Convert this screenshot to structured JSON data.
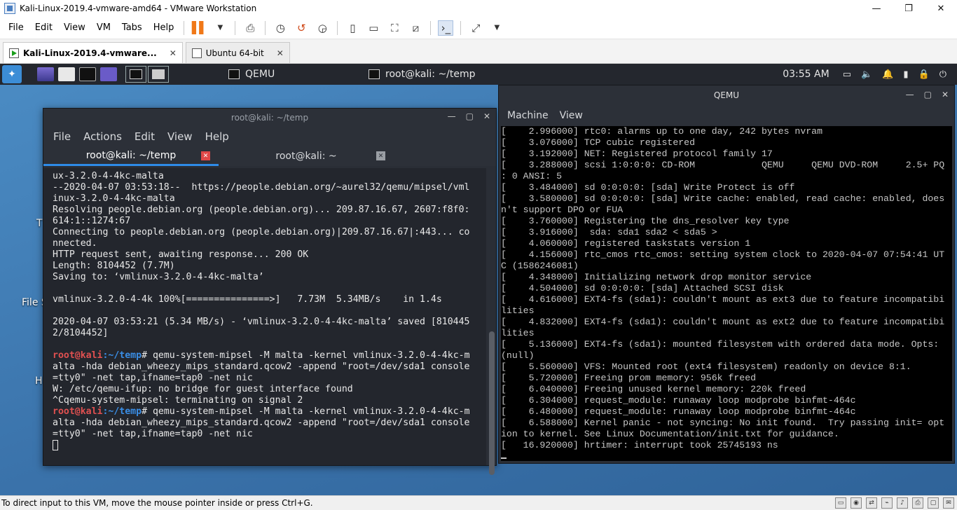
{
  "window": {
    "title": "Kali-Linux-2019.4-vmware-amd64 - VMware Workstation",
    "controls": {
      "minimize": "—",
      "maximize": "❐",
      "close": "✕"
    }
  },
  "menubar": {
    "items": [
      "File",
      "Edit",
      "View",
      "VM",
      "Tabs",
      "Help"
    ]
  },
  "toolbar": {
    "icons": [
      "pause-icon",
      "dropdown-icon",
      "send-keys-icon",
      "snapshot-icon",
      "revert-snapshot-icon",
      "snapshot-manager-icon",
      "sidebar-icon",
      "console-icon",
      "fullscreen-icon",
      "unity-icon",
      "terminal-icon",
      "stretch-icon"
    ]
  },
  "tabs": [
    {
      "label": "Kali-Linux-2019.4-vmware...",
      "active": true
    },
    {
      "label": "Ubuntu 64-bit",
      "active": false
    }
  ],
  "kali_panel": {
    "task1": "QEMU",
    "task2": "root@kali: ~/temp",
    "clock": "03:55 AM"
  },
  "desktop": {
    "label_t": "T",
    "label_file": "File S",
    "label_h": "H"
  },
  "terminal": {
    "title": "root@kali: ~/temp",
    "menu": [
      "File",
      "Actions",
      "Edit",
      "View",
      "Help"
    ],
    "tabs": [
      {
        "label": "root@kali: ~/temp",
        "close": "✕"
      },
      {
        "label": "root@kali: ~",
        "close": "✕"
      }
    ],
    "lines": [
      "ux-3.2.0-4-4kc-malta",
      "--2020-04-07 03:53:18--  https://people.debian.org/~aurel32/qemu/mipsel/vml",
      "inux-3.2.0-4-4kc-malta",
      "Resolving people.debian.org (people.debian.org)... 209.87.16.67, 2607:f8f0:",
      "614:1::1274:67",
      "Connecting to people.debian.org (people.debian.org)|209.87.16.67|:443... co",
      "nnected.",
      "HTTP request sent, awaiting response... 200 OK",
      "Length: 8104452 (7.7M)",
      "Saving to: ‘vmlinux-3.2.0-4-4kc-malta’",
      "",
      "vmlinux-3.2.0-4-4k 100%[===============>]   7.73M  5.34MB/s    in 1.4s",
      "",
      "2020-04-07 03:53:21 (5.34 MB/s) - ‘vmlinux-3.2.0-4-4kc-malta’ saved [810445",
      "2/8104452]",
      ""
    ],
    "prompt_user": "root@kali",
    "prompt_sep": ":",
    "prompt_path": "~/temp",
    "prompt_end": "# ",
    "cmd1_first": "qemu-system-mipsel -M malta -kernel vmlinux-3.2.0-4-4kc-m",
    "cmd1_rest": [
      "alta -hda debian_wheezy_mips_standard.qcow2 -append \"root=/dev/sda1 console",
      "=tty0\" -net tap,ifname=tap0 -net nic",
      "W: /etc/qemu-ifup: no bridge for guest interface found",
      "^Cqemu-system-mipsel: terminating on signal 2"
    ],
    "cmd2_first": "qemu-system-mipsel -M malta -kernel vmlinux-3.2.0-4-4kc-m",
    "cmd2_rest": [
      "alta -hda debian_wheezy_mips_standard.qcow2 -append \"root=/dev/sda1 console",
      "=tty0\" -net tap,ifname=tap0 -net nic"
    ]
  },
  "qemu": {
    "title": "QEMU",
    "menu": [
      "Machine",
      "View"
    ],
    "lines": [
      "[    2.996000] rtc0: alarms up to one day, 242 bytes nvram",
      "[    3.076000] TCP cubic registered",
      "[    3.192000] NET: Registered protocol family 17",
      "[    3.288000] scsi 1:0:0:0: CD-ROM            QEMU     QEMU DVD-ROM     2.5+ PQ",
      ": 0 ANSI: 5",
      "[    3.484000] sd 0:0:0:0: [sda] Write Protect is off",
      "[    3.580000] sd 0:0:0:0: [sda] Write cache: enabled, read cache: enabled, does",
      "n't support DPO or FUA",
      "[    3.760000] Registering the dns_resolver key type",
      "[    3.916000]  sda: sda1 sda2 < sda5 >",
      "[    4.060000] registered taskstats version 1",
      "[    4.156000] rtc_cmos rtc_cmos: setting system clock to 2020-04-07 07:54:41 UT",
      "C (1586246081)",
      "[    4.348000] Initializing network drop monitor service",
      "[    4.504000] sd 0:0:0:0: [sda] Attached SCSI disk",
      "[    4.616000] EXT4-fs (sda1): couldn't mount as ext3 due to feature incompatibi",
      "lities",
      "[    4.832000] EXT4-fs (sda1): couldn't mount as ext2 due to feature incompatibi",
      "lities",
      "[    5.136000] EXT4-fs (sda1): mounted filesystem with ordered data mode. Opts:",
      "(null)",
      "[    5.560000] VFS: Mounted root (ext4 filesystem) readonly on device 8:1.",
      "[    5.720000] Freeing prom memory: 956k freed",
      "[    6.040000] Freeing unused kernel memory: 220k freed",
      "[    6.304000] request_module: runaway loop modprobe binfmt-464c",
      "[    6.480000] request_module: runaway loop modprobe binfmt-464c",
      "[    6.588000] Kernel panic - not syncing: No init found.  Try passing init= opt",
      "ion to kernel. See Linux Documentation/init.txt for guidance.",
      "[   16.920000] hrtimer: interrupt took 25745193 ns"
    ]
  },
  "statusbar": {
    "text": "To direct input to this VM, move the mouse pointer inside or press Ctrl+G."
  }
}
